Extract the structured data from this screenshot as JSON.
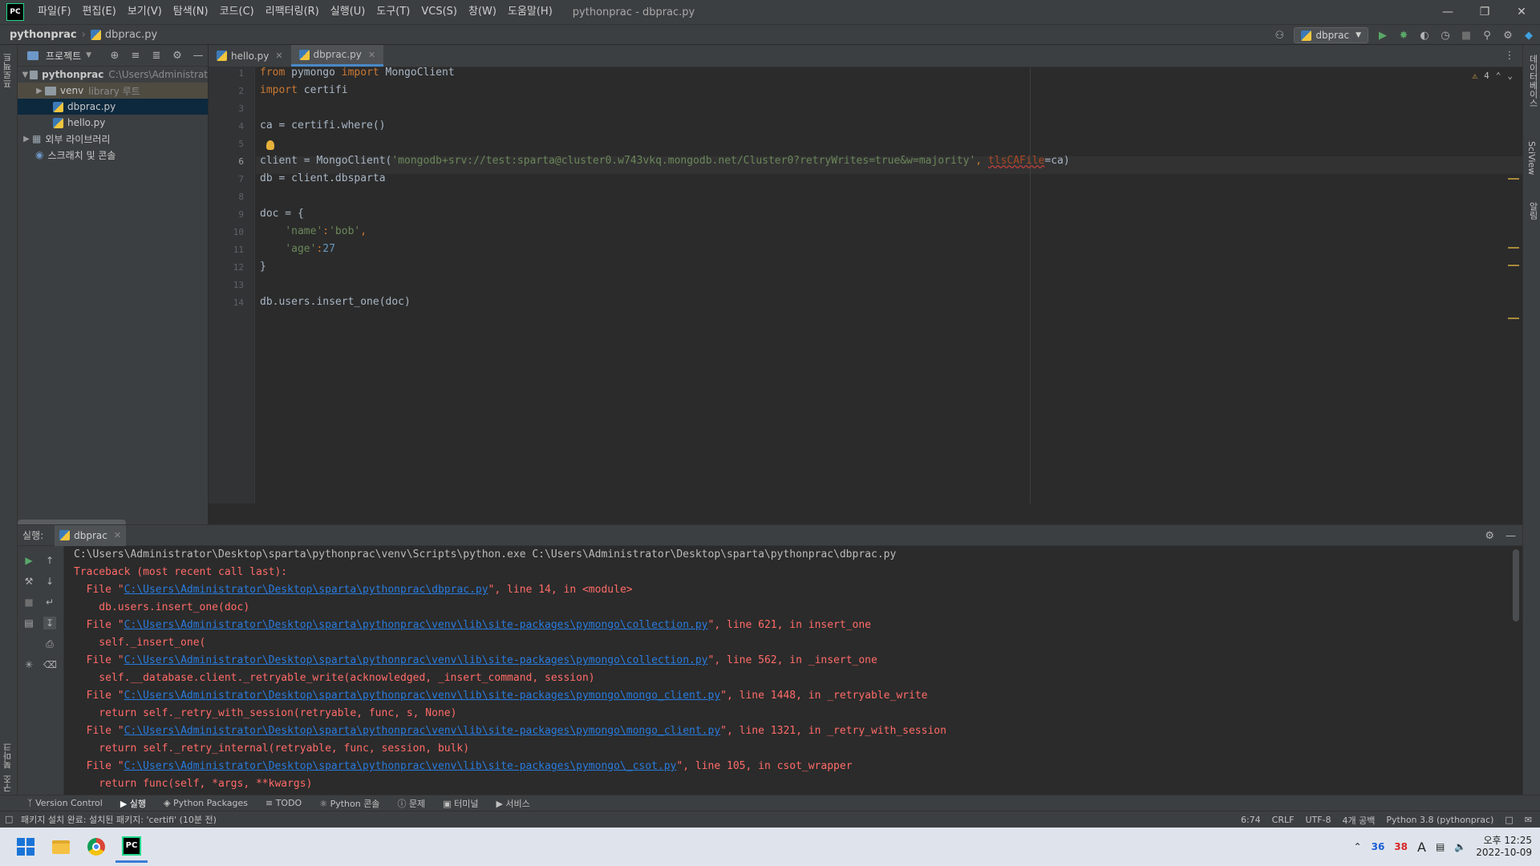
{
  "app": {
    "logo_text": "PC",
    "window_title": "pythonprac - dbprac.py",
    "menu": [
      "파일(F)",
      "편집(E)",
      "보기(V)",
      "탐색(N)",
      "코드(C)",
      "리팩터링(R)",
      "실행(U)",
      "도구(T)",
      "VCS(S)",
      "창(W)",
      "도움말(H)"
    ]
  },
  "navbar": {
    "project": "pythonprac",
    "file": "dbprac.py",
    "run_config": "dbprac"
  },
  "stripes": {
    "left_top": "프로젝트",
    "left_bottom_1": "북마크",
    "left_bottom_2": "구조",
    "right_1": "데이터베이스",
    "right_2": "SciView",
    "right_3": "알림"
  },
  "project_panel": {
    "title": "프로젝트",
    "tree": [
      {
        "label": "pythonprac",
        "hint": "C:\\Users\\Administrat",
        "bold": true
      },
      {
        "label": "venv",
        "hint": "library 루트"
      },
      {
        "label": "dbprac.py"
      },
      {
        "label": "hello.py"
      },
      {
        "label": "외부 라이브러리"
      },
      {
        "label": "스크래치 및 콘솔"
      }
    ]
  },
  "editor": {
    "tabs": [
      {
        "label": "hello.py"
      },
      {
        "label": "dbprac.py"
      }
    ],
    "warnings_count": "4",
    "current_line": 6,
    "lines": [
      {
        "n": "1"
      },
      {
        "n": "2"
      },
      {
        "n": "3"
      },
      {
        "n": "4"
      },
      {
        "n": "5"
      },
      {
        "n": "6"
      },
      {
        "n": "7"
      },
      {
        "n": "8"
      },
      {
        "n": "9"
      },
      {
        "n": "10"
      },
      {
        "n": "11"
      },
      {
        "n": "12"
      },
      {
        "n": "13"
      },
      {
        "n": "14"
      }
    ],
    "code": {
      "l1_kw1": "from",
      "l1_mod": " pymongo ",
      "l1_kw2": "import",
      "l1_rest": " MongoClient",
      "l2_kw": "import",
      "l2_rest": " certifi",
      "l4": "ca = certifi.where()",
      "l6_a": "client = MongoClient(",
      "l6_str": "'mongodb+srv://test:sparta@cluster0.w743vkq.mongodb.net/Cluster0?retryWrites=true&w=majority'",
      "l6_comma": ", ",
      "l6_param": "tlsCAFile",
      "l6_end": "=ca)",
      "l7": "db = client.dbsparta",
      "l9": "doc = {",
      "l10_key": "'name'",
      "l10_colon": ":",
      "l10_val": "'bob'",
      "l10_comma": ",",
      "l11_key": "'age'",
      "l11_colon": ":",
      "l11_val": "27",
      "l12": "}",
      "l14": "db.users.insert_one(doc)"
    }
  },
  "run_panel": {
    "label": "실행:",
    "tab": "dbprac",
    "console": [
      {
        "type": "plain",
        "text": "C:\\Users\\Administrator\\Desktop\\sparta\\pythonprac\\venv\\Scripts\\python.exe C:\\Users\\Administrator\\Desktop\\sparta\\pythonprac\\dbprac.py"
      },
      {
        "type": "err",
        "text": "Traceback (most recent call last):"
      },
      {
        "type": "err",
        "pre": "  File \"",
        "link": "C:\\Users\\Administrator\\Desktop\\sparta\\pythonprac\\dbprac.py",
        "post": "\", line 14, in <module>"
      },
      {
        "type": "err",
        "text": "    db.users.insert_one(doc)"
      },
      {
        "type": "err",
        "pre": "  File \"",
        "link": "C:\\Users\\Administrator\\Desktop\\sparta\\pythonprac\\venv\\lib\\site-packages\\pymongo\\collection.py",
        "post": "\", line 621, in insert_one"
      },
      {
        "type": "err",
        "text": "    self._insert_one("
      },
      {
        "type": "err",
        "pre": "  File \"",
        "link": "C:\\Users\\Administrator\\Desktop\\sparta\\pythonprac\\venv\\lib\\site-packages\\pymongo\\collection.py",
        "post": "\", line 562, in _insert_one"
      },
      {
        "type": "err",
        "text": "    self.__database.client._retryable_write(acknowledged, _insert_command, session)"
      },
      {
        "type": "err",
        "pre": "  File \"",
        "link": "C:\\Users\\Administrator\\Desktop\\sparta\\pythonprac\\venv\\lib\\site-packages\\pymongo\\mongo_client.py",
        "post": "\", line 1448, in _retryable_write"
      },
      {
        "type": "err",
        "text": "    return self._retry_with_session(retryable, func, s, None)"
      },
      {
        "type": "err",
        "pre": "  File \"",
        "link": "C:\\Users\\Administrator\\Desktop\\sparta\\pythonprac\\venv\\lib\\site-packages\\pymongo\\mongo_client.py",
        "post": "\", line 1321, in _retry_with_session"
      },
      {
        "type": "err",
        "text": "    return self._retry_internal(retryable, func, session, bulk)"
      },
      {
        "type": "err",
        "pre": "  File \"",
        "link": "C:\\Users\\Administrator\\Desktop\\sparta\\pythonprac\\venv\\lib\\site-packages\\pymongo\\_csot.py",
        "post": "\", line 105, in csot_wrapper"
      },
      {
        "type": "err",
        "text": "    return func(self, *args, **kwargs)"
      }
    ]
  },
  "toolwindows": [
    "Version Control",
    "실행",
    "Python Packages",
    "TODO",
    "Python 콘솔",
    "문제",
    "터미널",
    "서비스"
  ],
  "statusbar": {
    "message": "패키지 설치 완료: 설치된 패키지: 'certifi' (10분 전)",
    "position": "6:74",
    "line_sep": "CRLF",
    "encoding": "UTF-8",
    "indent": "4개 공백",
    "interpreter": "Python 3.8 (pythonprac)"
  },
  "taskbar": {
    "tray_num1": "36",
    "tray_num2": "38",
    "ime": "A",
    "time": "오후 12:25",
    "date": "2022-10-09"
  }
}
